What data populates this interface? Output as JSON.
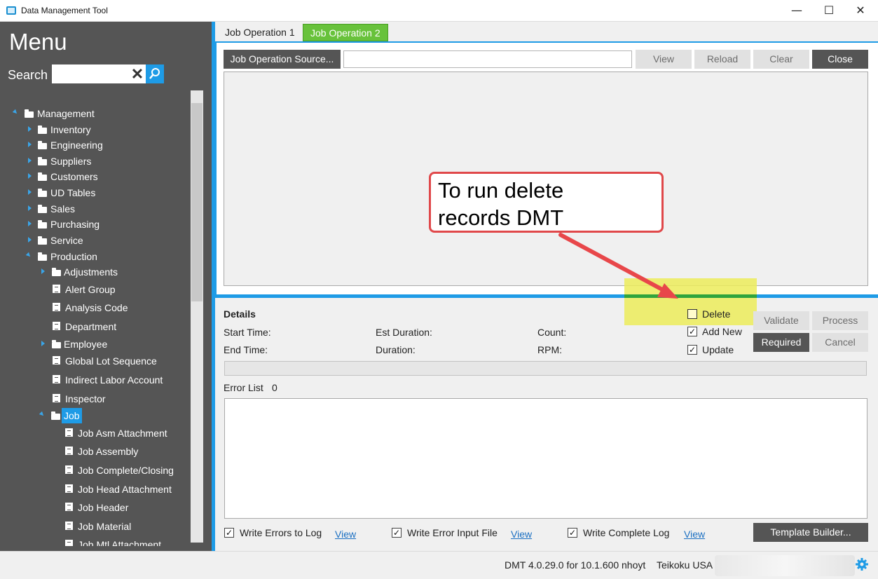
{
  "window": {
    "title": "Data Management Tool",
    "minimize": "—",
    "maximize": "☐",
    "close": "✕"
  },
  "sidebar": {
    "menu_title": "Menu",
    "search_label": "Search",
    "search_value": "",
    "tree": [
      {
        "label": "Management",
        "type": "folder",
        "expanded": true
      },
      {
        "label": "Inventory",
        "type": "folder"
      },
      {
        "label": "Engineering",
        "type": "folder"
      },
      {
        "label": "Suppliers",
        "type": "folder"
      },
      {
        "label": "Customers",
        "type": "folder"
      },
      {
        "label": "UD Tables",
        "type": "folder"
      },
      {
        "label": "Sales",
        "type": "folder"
      },
      {
        "label": "Purchasing",
        "type": "folder"
      },
      {
        "label": "Service",
        "type": "folder"
      },
      {
        "label": "Production",
        "type": "folder",
        "expanded": true
      },
      {
        "label": "Adjustments",
        "type": "folder"
      },
      {
        "label": "Alert Group",
        "type": "doc"
      },
      {
        "label": "Analysis Code",
        "type": "doc"
      },
      {
        "label": "Department",
        "type": "doc"
      },
      {
        "label": "Employee",
        "type": "folder"
      },
      {
        "label": "Global Lot Sequence",
        "type": "doc"
      },
      {
        "label": "Indirect Labor Account",
        "type": "doc"
      },
      {
        "label": "Inspector",
        "type": "doc"
      },
      {
        "label": "Job",
        "type": "folder",
        "expanded": true,
        "selected": true
      },
      {
        "label": "Job Asm Attachment",
        "type": "doc"
      },
      {
        "label": "Job Assembly",
        "type": "doc"
      },
      {
        "label": "Job Complete/Closing",
        "type": "doc"
      },
      {
        "label": "Job Head Attachment",
        "type": "doc"
      },
      {
        "label": "Job Header",
        "type": "doc"
      },
      {
        "label": "Job Material",
        "type": "doc"
      },
      {
        "label": "Job Mtl Attachment",
        "type": "doc"
      }
    ]
  },
  "tabs": [
    {
      "label": "Job Operation 1",
      "active": false
    },
    {
      "label": "Job Operation 2",
      "active": true
    }
  ],
  "toolbar": {
    "source_button": "Job Operation Source...",
    "source_value": "",
    "view": "View",
    "reload": "Reload",
    "clear": "Clear",
    "close": "Close"
  },
  "details": {
    "heading": "Details",
    "start_time": "Start Time:",
    "end_time": "End Time:",
    "est_duration": "Est Duration:",
    "duration": "Duration:",
    "count": "Count:",
    "rpm": "RPM:",
    "delete": "Delete",
    "add_new": "Add New",
    "update": "Update",
    "delete_checked": false,
    "add_new_checked": true,
    "update_checked": true,
    "validate": "Validate",
    "process": "Process",
    "required": "Required",
    "cancel": "Cancel",
    "error_list_label": "Error List",
    "error_count": "0"
  },
  "footer_options": {
    "write_errors": "Write Errors to Log",
    "write_error_input": "Write Error Input File",
    "write_complete": "Write Complete Log",
    "view": "View",
    "template_builder": "Template Builder..."
  },
  "status": {
    "version": "DMT 4.0.29.0 for 10.1.600",
    "user": "nhoyt",
    "company": "Teikoku USA"
  },
  "annotation": {
    "callout_text": "To run delete\nrecords DMT"
  },
  "colors": {
    "accent_blue": "#1e9be6",
    "active_tab_green": "#68c23b",
    "sidebar_bg": "#555555",
    "callout_red": "#e0484a",
    "highlight_yellow": "#ecec5a"
  }
}
